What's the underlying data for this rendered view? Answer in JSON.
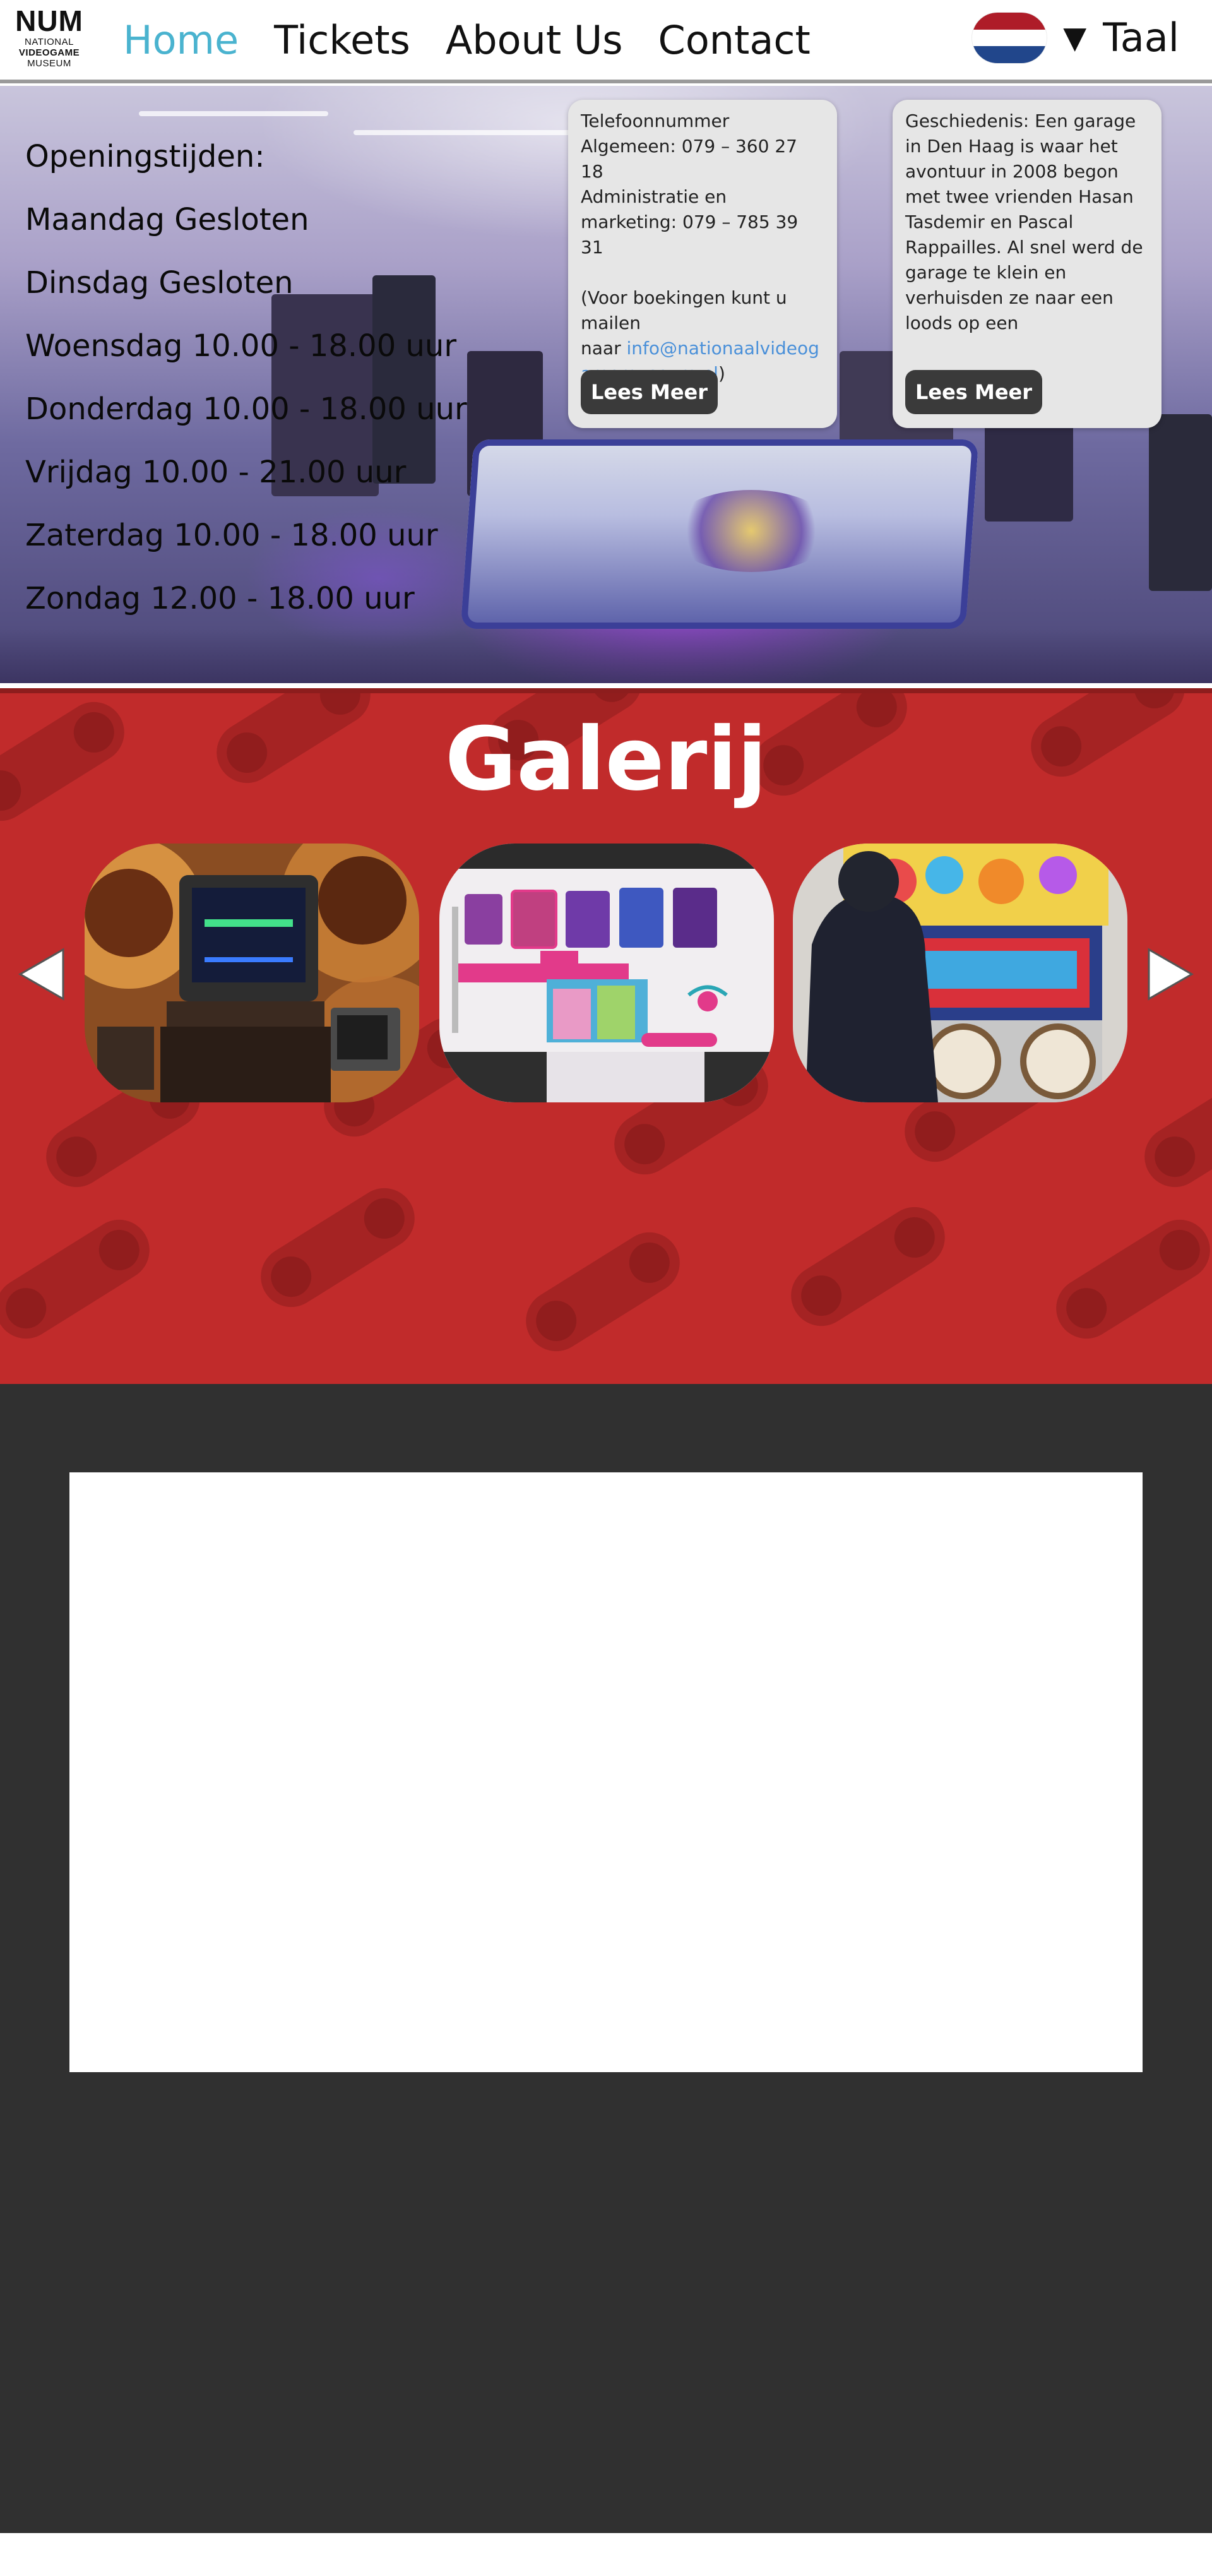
{
  "header": {
    "logo": {
      "mark": "NUM",
      "line1": "NATIONAL",
      "line2": "VIDEOGAME",
      "line3": "MUSEUM"
    },
    "nav": [
      {
        "label": "Home",
        "active": true
      },
      {
        "label": "Tickets",
        "active": false
      },
      {
        "label": "About Us",
        "active": false
      },
      {
        "label": "Contact",
        "active": false
      }
    ],
    "language": {
      "caret": "▼",
      "label": "Taal",
      "flag_colors": [
        "#ae1c28",
        "#ffffff",
        "#21468b"
      ]
    }
  },
  "hero": {
    "hours": [
      "Openingstijden:",
      "Maandag Gesloten",
      "Dinsdag Gesloten",
      "Woensdag 10.00 - 18.00 uur",
      "Donderdag 10.00 - 18.00 uur",
      "Vrijdag 10.00 - 21.00 uur",
      "Zaterdag 10.00 - 18.00 uur",
      "Zondag 12.00 - 18.00 uur"
    ],
    "contact_card": {
      "text_before": "Telefoonnummer Algemeen: 079 – 360 27 18\nAdministratie en marketing: 079 – 785 39 31\n\n(Voor boekingen kunt u mailen\nnaar ",
      "email": "info@nationaalvideogamemuseum.nl",
      "text_after": ")",
      "button": "Lees Meer"
    },
    "history_card": {
      "text": "Geschiedenis: Een garage in Den Haag is waar het avontuur in 2008 begon met twee vrienden Hasan Tasdemir en Pascal Rappailles. Al snel werd de garage te klein en verhuisden ze naar een loods op een",
      "button": "Lees Meer"
    }
  },
  "gallery": {
    "title": "Galerij",
    "slides": [
      "retro-tv-setup-photo",
      "just-dance-screen-photo",
      "drum-arcade-machine-photo"
    ]
  },
  "colors": {
    "accent": "#4ab3cf",
    "gallery_bg": "#c12b2b",
    "dark_bg": "#303030",
    "button_bg": "#3a3a3a"
  }
}
